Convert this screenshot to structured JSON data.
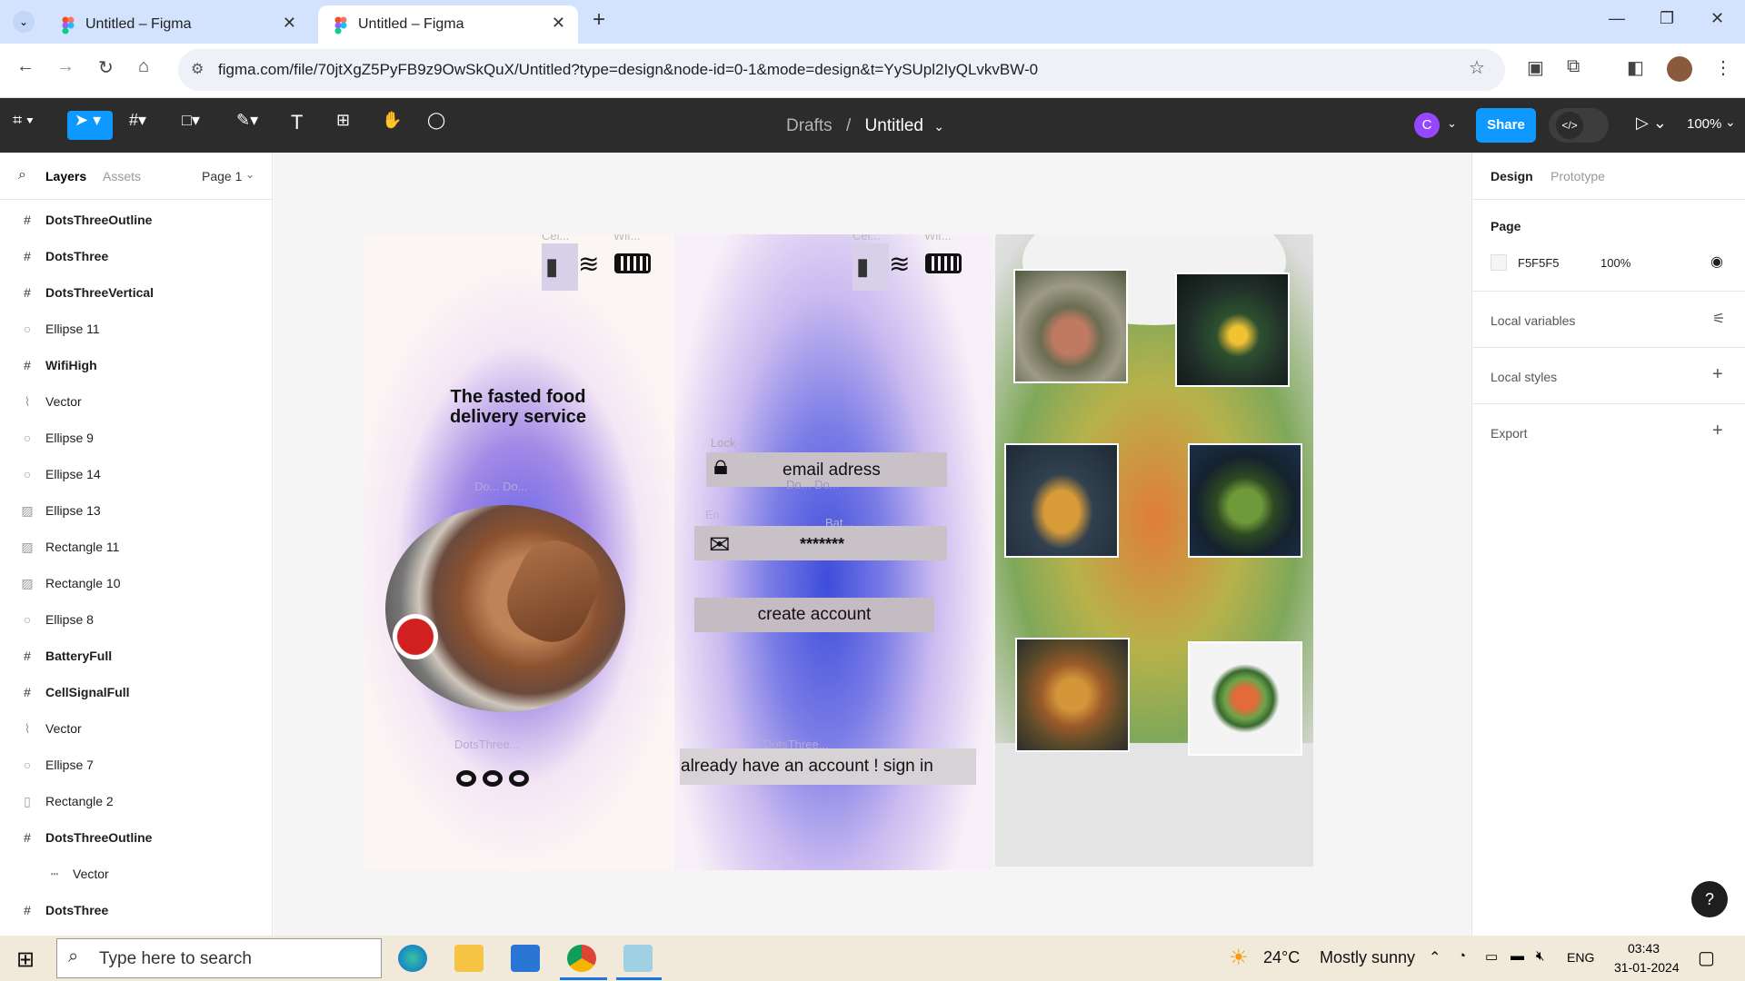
{
  "browser": {
    "tabs": [
      {
        "title": "Untitled – Figma"
      },
      {
        "title": "Untitled – Figma"
      }
    ],
    "new_tab": "+",
    "url": "figma.com/file/70jtXgZ5PyFB9z9OwSkQuX/Untitled?type=design&node-id=0-1&mode=design&t=YySUpl2IyQLvkvBW-0"
  },
  "toolbar": {
    "breadcrumb_parent": "Drafts",
    "breadcrumb_sep": "/",
    "file_name": "Untitled",
    "avatar_letter": "C",
    "share_label": "Share",
    "zoom": "100%",
    "code_label": "</>"
  },
  "left_panel": {
    "tabs": {
      "layers": "Layers",
      "assets": "Assets"
    },
    "page": "Page 1",
    "layers": [
      {
        "name": "DotsThreeOutline",
        "icon": "frame"
      },
      {
        "name": "DotsThree",
        "icon": "frame"
      },
      {
        "name": "DotsThreeVertical",
        "icon": "frame"
      },
      {
        "name": "Ellipse 11",
        "icon": "ellipse"
      },
      {
        "name": "WifiHigh",
        "icon": "frame"
      },
      {
        "name": "Vector",
        "icon": "vector"
      },
      {
        "name": "Ellipse 9",
        "icon": "ellipse"
      },
      {
        "name": "Ellipse 14",
        "icon": "ellipse"
      },
      {
        "name": "Ellipse 13",
        "icon": "image"
      },
      {
        "name": "Rectangle 11",
        "icon": "image"
      },
      {
        "name": "Rectangle 10",
        "icon": "image"
      },
      {
        "name": "Ellipse 8",
        "icon": "ellipse"
      },
      {
        "name": "BatteryFull",
        "icon": "frame"
      },
      {
        "name": "CellSignalFull",
        "icon": "frame"
      },
      {
        "name": "Vector",
        "icon": "vector"
      },
      {
        "name": "Ellipse 7",
        "icon": "ellipse"
      },
      {
        "name": "Rectangle 2",
        "icon": "rect"
      },
      {
        "name": "DotsThreeOutline",
        "icon": "frame"
      },
      {
        "name": "Vector",
        "icon": "line"
      },
      {
        "name": "DotsThree",
        "icon": "frame"
      }
    ]
  },
  "right_panel": {
    "tabs": {
      "design": "Design",
      "prototype": "Prototype"
    },
    "page_label": "Page",
    "page_color": "F5F5F5",
    "page_opacity": "100%",
    "local_variables": "Local variables",
    "local_styles": "Local styles",
    "export": "Export"
  },
  "canvas": {
    "screen1": {
      "cel": "Cel...",
      "wif": "Wif...",
      "headline": "The fasted food delivery service",
      "do_label": "Do...   Do...",
      "dots_label": "DotsThree..."
    },
    "screen2": {
      "cel": "Cel...",
      "wif": "Wif...",
      "lock_label": "Lock",
      "email_placeholder": "email adress",
      "do_label": "Do...   Do...",
      "en_label": "En...",
      "bat_label": "Bat...",
      "password": "*******",
      "create_button": "create account",
      "dots_label": "DotsThree...",
      "signin_text": "already have an account ! sign in"
    }
  },
  "taskbar": {
    "search_placeholder": "Type here to search",
    "weather_temp": "24°C",
    "weather_desc": "Mostly sunny",
    "lang": "ENG",
    "time": "03:43",
    "date": "31-01-2024"
  },
  "colors": {
    "figma_dark": "#2c2c2c",
    "accent": "#0d99ff",
    "tabbar": "#d3e3fd",
    "canvas": "#f5f5f5"
  }
}
